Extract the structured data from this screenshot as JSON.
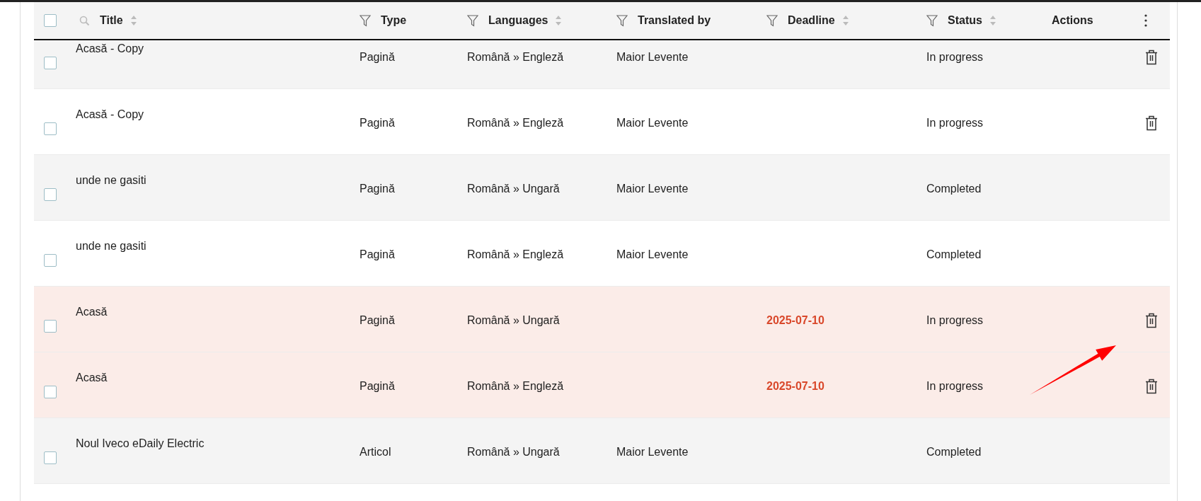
{
  "table": {
    "select_all": {
      "checked": false
    },
    "columns": [
      {
        "label": "Title",
        "kind": "search",
        "sortable": true
      },
      {
        "label": "Type",
        "kind": "filter",
        "sortable": false
      },
      {
        "label": "Languages",
        "kind": "filter",
        "sortable": true
      },
      {
        "label": "Translated by",
        "kind": "filter",
        "sortable": false
      },
      {
        "label": "Deadline",
        "kind": "filter",
        "sortable": true
      },
      {
        "label": "Status",
        "kind": "filter",
        "sortable": true
      },
      {
        "label": "Actions",
        "kind": "plain",
        "sortable": false
      }
    ],
    "rows": [
      {
        "checked": false,
        "highlighted": false,
        "title": "Acasă - Copy",
        "type": "Pagină",
        "languages": "Română » Engleză",
        "translated_by": "Maior Levente",
        "deadline": "",
        "status": "In progress",
        "deletable": true
      },
      {
        "checked": false,
        "highlighted": false,
        "title": "Acasă - Copy",
        "type": "Pagină",
        "languages": "Română » Engleză",
        "translated_by": "Maior Levente",
        "deadline": "",
        "status": "In progress",
        "deletable": true
      },
      {
        "checked": false,
        "highlighted": false,
        "title": "unde ne gasiti",
        "type": "Pagină",
        "languages": "Română » Ungară",
        "translated_by": "Maior Levente",
        "deadline": "",
        "status": "Completed",
        "deletable": false
      },
      {
        "checked": false,
        "highlighted": false,
        "title": "unde ne gasiti",
        "type": "Pagină",
        "languages": "Română » Engleză",
        "translated_by": "Maior Levente",
        "deadline": "",
        "status": "Completed",
        "deletable": false
      },
      {
        "checked": false,
        "highlighted": true,
        "title": "Acasă",
        "type": "Pagină",
        "languages": "Română » Ungară",
        "translated_by": "",
        "deadline": "2025-07-10",
        "status": "In progress",
        "deletable": true
      },
      {
        "checked": false,
        "highlighted": true,
        "title": "Acasă",
        "type": "Pagină",
        "languages": "Română » Engleză",
        "translated_by": "",
        "deadline": "2025-07-10",
        "status": "In progress",
        "deletable": true
      },
      {
        "checked": false,
        "highlighted": false,
        "title": "Noul Iveco eDaily Electric",
        "type": "Articol",
        "languages": "Română » Ungară",
        "translated_by": "Maior Levente",
        "deadline": "",
        "status": "Completed",
        "deletable": false
      }
    ]
  }
}
